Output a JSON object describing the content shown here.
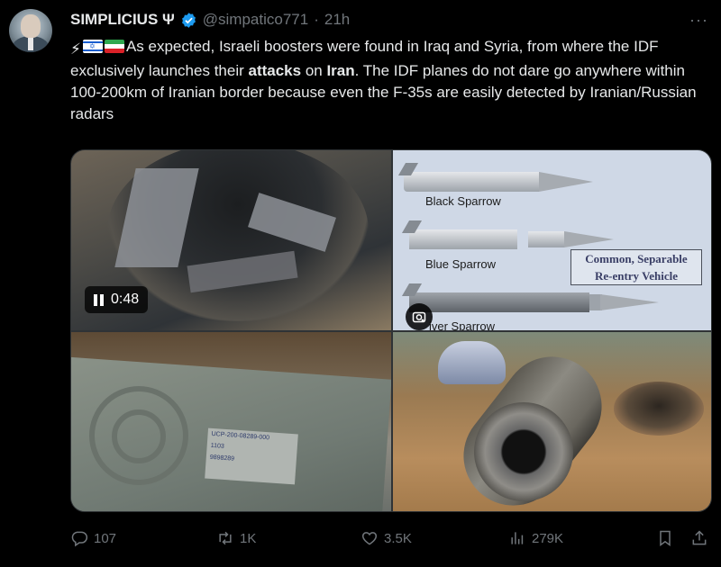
{
  "author": {
    "name": "SIMPLICIUS Ψ",
    "handle": "@simpatico771",
    "separator": "·",
    "time": "21h",
    "verified": true,
    "avatar_icon": "profile-portrait"
  },
  "more_menu_label": "···",
  "tweet": {
    "emoji": "⚡",
    "flags": [
      "israel-flag",
      "iran-flag"
    ],
    "text_1": "As expected, Israeli boosters were found in Iraq and Syria, from where the IDF exclusively launches their ",
    "bold_1": "attacks",
    "text_2": " on ",
    "bold_2": "Iran",
    "text_3": ". The IDF planes do not dare go anywhere within 100-200km of Iranian border because even the F-35s are easily detected by Iranian/Russian radars"
  },
  "media": {
    "video": {
      "duration": "0:48",
      "icon": "pause-icon"
    },
    "diagram": {
      "labels": [
        "Black Sparrow",
        "Blue Sparrow",
        "iver Sparrow"
      ],
      "callout_line1": "Common, Separable",
      "callout_line2": "Re-entry Vehicle",
      "lens_icon": "google-lens-icon"
    },
    "photo3": {
      "decal_line1": "UCP-200-08289-000",
      "decal_line2": "1103",
      "decal_line3": "9898289"
    },
    "photo4": {}
  },
  "actions": {
    "replies": "107",
    "reposts": "1K",
    "likes": "3.5K",
    "views": "279K",
    "icons": [
      "reply-icon",
      "repost-icon",
      "like-icon",
      "views-icon",
      "bookmark-icon",
      "share-icon"
    ]
  },
  "colors": {
    "background": "#000000",
    "text": "#e7e9ea",
    "muted": "#71767b",
    "verified_blue": "#1d9bf0"
  }
}
